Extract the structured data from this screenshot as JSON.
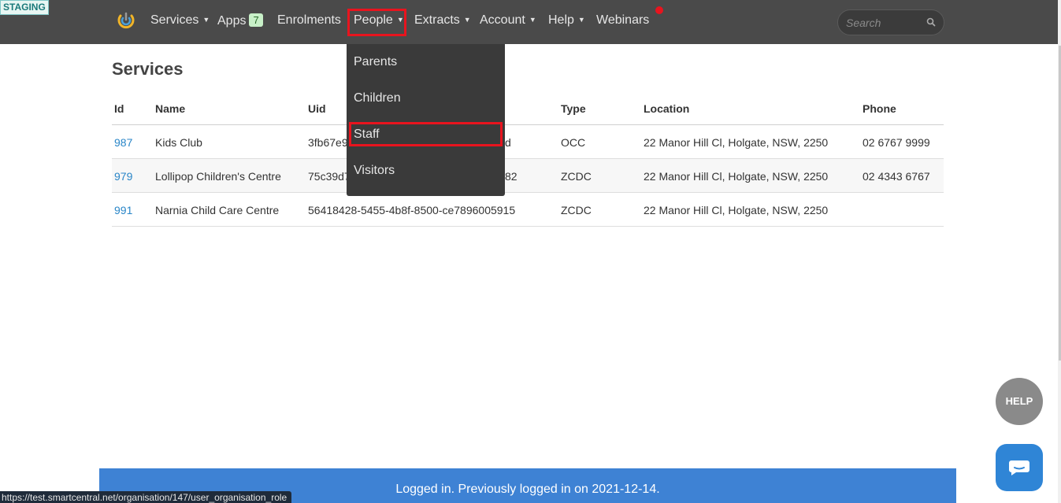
{
  "env_badge": "STAGING",
  "nav": {
    "items": [
      {
        "label": "Services",
        "has_caret": true
      },
      {
        "label": "Apps",
        "badge": "7"
      },
      {
        "label": "Enrolments"
      },
      {
        "label": "People",
        "has_caret": true
      },
      {
        "label": "Extracts",
        "has_caret": true
      },
      {
        "label": "Account",
        "has_caret": true
      },
      {
        "label": "Help",
        "has_caret": true
      },
      {
        "label": "Webinars"
      }
    ],
    "caret_glyph": "▼",
    "search_placeholder": "Search"
  },
  "dropdown": {
    "items": [
      "Parents",
      "Children",
      "Staff",
      "Visitors"
    ]
  },
  "page_title": "Services",
  "table": {
    "headers": [
      "Id",
      "Name",
      "Uid",
      "Type",
      "Location",
      "Phone"
    ],
    "rows": [
      {
        "id": "987",
        "name": "Kids Club",
        "uid": "3fb67e9",
        "uid_tail": "d",
        "type": "OCC",
        "location": "22 Manor Hill Cl, Holgate, NSW, 2250",
        "phone": "02 6767 9999"
      },
      {
        "id": "979",
        "name": "Lollipop Children's Centre",
        "uid": "75c39d7",
        "uid_tail": "82",
        "type": "ZCDC",
        "location": "22 Manor Hill Cl, Holgate, NSW, 2250",
        "phone": "02 4343 6767"
      },
      {
        "id": "991",
        "name": "Narnia Child Care Centre",
        "uid": "56418428-5455-4b8f-8500-ce7896005915",
        "uid_tail": "",
        "type": "ZCDC",
        "location": "22 Manor Hill Cl, Holgate, NSW, 2250",
        "phone": ""
      }
    ]
  },
  "help_button": "HELP",
  "footer_text": "Logged in. Previously logged in on 2021-12-14.",
  "status_url": "https://test.smartcentral.net/organisation/147/user_organisation_role",
  "colors": {
    "navbar": "#4a4a4a",
    "dropdown": "#3a3a3a",
    "highlight": "#e8141e",
    "link": "#2a86c8",
    "footer": "#3e82d4",
    "chat": "#2f85d6"
  }
}
